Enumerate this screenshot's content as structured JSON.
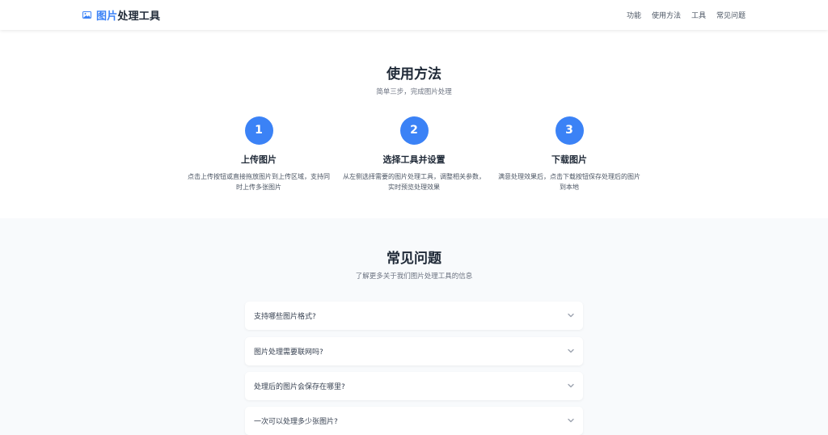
{
  "header": {
    "brand_accent": "图片",
    "brand_rest": "处理工具",
    "brand_icon": "image-icon",
    "nav": [
      "功能",
      "使用方法",
      "工具",
      "常见问题"
    ]
  },
  "how": {
    "title": "使用方法",
    "subtitle": "简单三步，完成图片处理",
    "steps": [
      {
        "num": "1",
        "title": "上传图片",
        "desc": "点击上传按钮或直接拖放图片到上传区域，支持同时上传多张图片"
      },
      {
        "num": "2",
        "title": "选择工具并设置",
        "desc": "从左侧选择需要的图片处理工具，调整相关参数，实时预览处理效果"
      },
      {
        "num": "3",
        "title": "下载图片",
        "desc": "满意处理效果后，点击下载按钮保存处理后的图片到本地"
      }
    ]
  },
  "faq": {
    "title": "常见问题",
    "subtitle": "了解更多关于我们图片处理工具的信息",
    "items": [
      {
        "q": "支持哪些图片格式?"
      },
      {
        "q": "图片处理需要联网吗?"
      },
      {
        "q": "处理后的图片会保存在哪里?"
      },
      {
        "q": "一次可以处理多少张图片?"
      }
    ]
  },
  "colors": {
    "accent": "#3b82f6",
    "text": "#1f2937",
    "muted": "#6b7280",
    "bg_alt": "#f8fafc"
  }
}
